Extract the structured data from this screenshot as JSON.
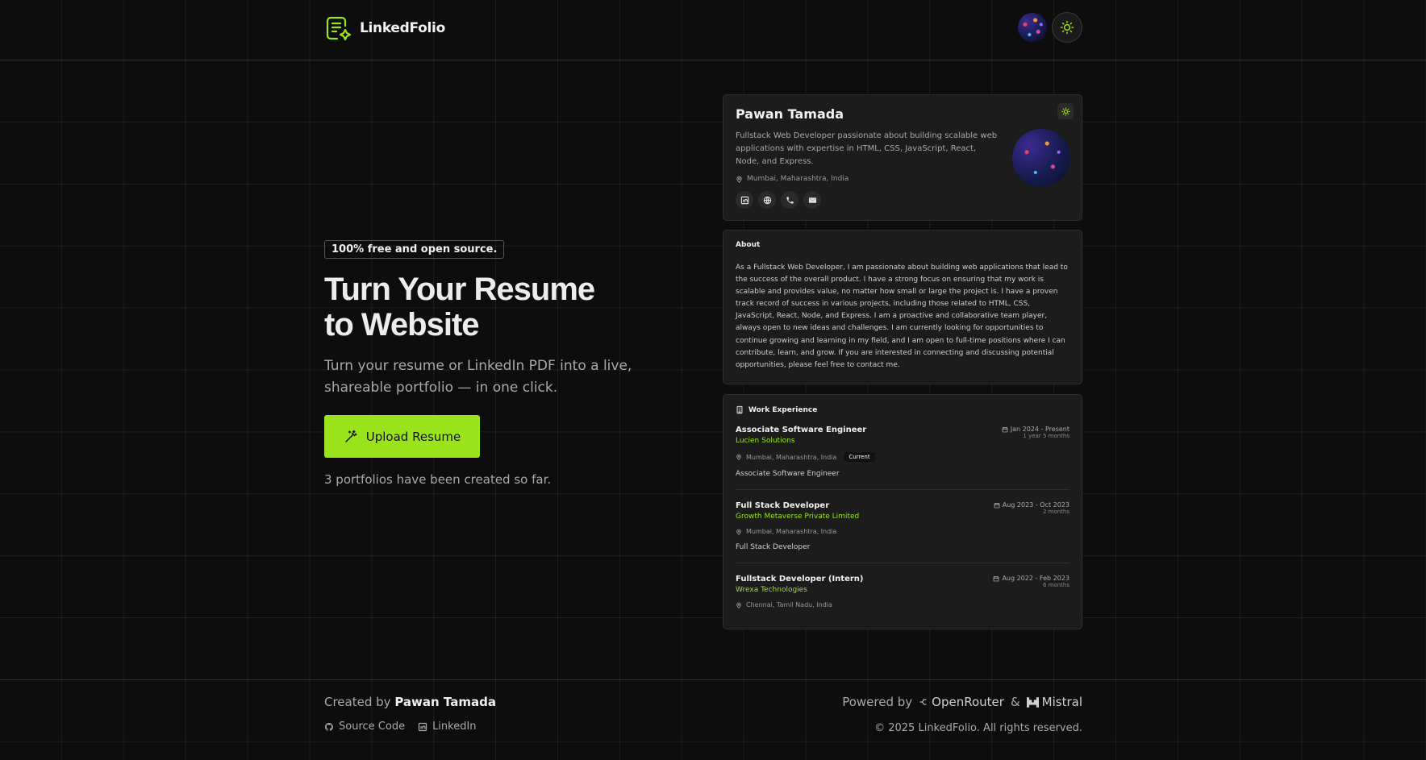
{
  "header": {
    "brand": "LinkedFolio"
  },
  "hero": {
    "badge": "100% free and open source.",
    "title_line1": "Turn Your Resume",
    "title_line2": "to Website",
    "subtitle": "Turn your resume or LinkedIn PDF into a live, shareable portfolio — in one click.",
    "upload_label": "Upload Resume",
    "count_text": "3 portfolios have been created so far."
  },
  "profile": {
    "name": "Pawan Tamada",
    "description": "Fullstack Web Developer passionate about building scalable web applications with expertise in HTML, CSS, JavaScript, React, Node, and Express.",
    "location": "Mumbai, Maharashtra, India"
  },
  "about": {
    "title": "About",
    "text": "As a Fullstack Web Developer, I am passionate about building web applications that lead to the success of the overall product. I have a strong focus on ensuring that my work is scalable and provides value, no matter how small or large the project is. I have a proven track record of success in various projects, including those related to HTML, CSS, JavaScript, React, Node, and Express. I am a proactive and collaborative team player, always open to new ideas and challenges. I am currently looking for opportunities to continue growing and learning in my field, and I am open to full-time positions where I can contribute, learn, and grow. If you are interested in connecting and discussing potential opportunities, please feel free to contact me."
  },
  "work": {
    "title": "Work Experience",
    "jobs": [
      {
        "title": "Associate Software Engineer",
        "company": "Lucien Solutions",
        "location": "Mumbai, Maharashtra, India",
        "badge": "Current",
        "description": "Associate Software Engineer",
        "dates": "Jan 2024 - Present",
        "duration": "1 year 5 months"
      },
      {
        "title": "Full Stack Developer",
        "company": "Growth Metaverse Private Limited",
        "location": "Mumbai, Maharashtra, India",
        "description": "Full Stack Developer",
        "dates": "Aug 2023 - Oct 2023",
        "duration": "2 months"
      },
      {
        "title": "Fullstack Developer (Intern)",
        "company": "Wrexa Technologies",
        "location": "Chennai, Tamil Nadu, India",
        "dates": "Aug 2022 - Feb 2023",
        "duration": "6 months"
      }
    ]
  },
  "footer": {
    "created_prefix": "Created by",
    "created_name": "Pawan Tamada",
    "source_code": "Source Code",
    "linkedin": "LinkedIn",
    "powered_by": "Powered by",
    "openrouter": "OpenRouter",
    "amp": "&",
    "mistral": "Mistral",
    "rights": "© 2025 LinkedFolio. All rights reserved."
  },
  "colors": {
    "accent": "#9be31a",
    "background": "#0d0d0d",
    "card": "#1c1c1c"
  }
}
